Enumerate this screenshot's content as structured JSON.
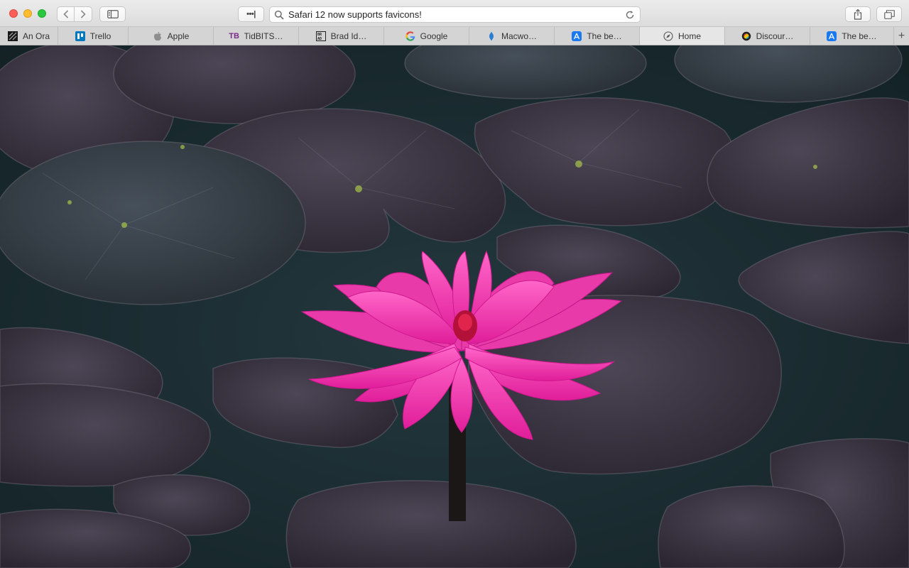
{
  "toolbar": {
    "more_label": "•••|",
    "address_text": "Safari 12 now supports favicons!"
  },
  "tabs": [
    {
      "label": "An Ora",
      "icon": "oracle-favicon-icon",
      "color": "#000000"
    },
    {
      "label": "Trello",
      "icon": "trello-icon",
      "color": "#0079bf"
    },
    {
      "label": "Apple",
      "icon": "apple-icon",
      "color": "#8e8e8e"
    },
    {
      "label": "TidBITS…",
      "icon": "tidbits-icon",
      "color": "#7a2a8a"
    },
    {
      "label": "Brad Id…",
      "icon": "brad-icon",
      "color": "#222222"
    },
    {
      "label": "Google",
      "icon": "google-icon",
      "color": "#4285f4"
    },
    {
      "label": "Macwo…",
      "icon": "macworld-icon",
      "color": "#2a7fd4"
    },
    {
      "label": "The be…",
      "icon": "app-store-icon",
      "color": "#1a78f0"
    },
    {
      "label": "Home",
      "icon": "compass-icon",
      "color": "#555555"
    },
    {
      "label": "Discour…",
      "icon": "discourse-icon",
      "color": "#f6c000"
    },
    {
      "label": "The be…",
      "icon": "app-store-icon",
      "color": "#1a78f0"
    }
  ],
  "add_tab_label": "+",
  "colors": {
    "petal": "#ff3db0",
    "water": "#1d2e33",
    "pad": "#3a3340"
  }
}
